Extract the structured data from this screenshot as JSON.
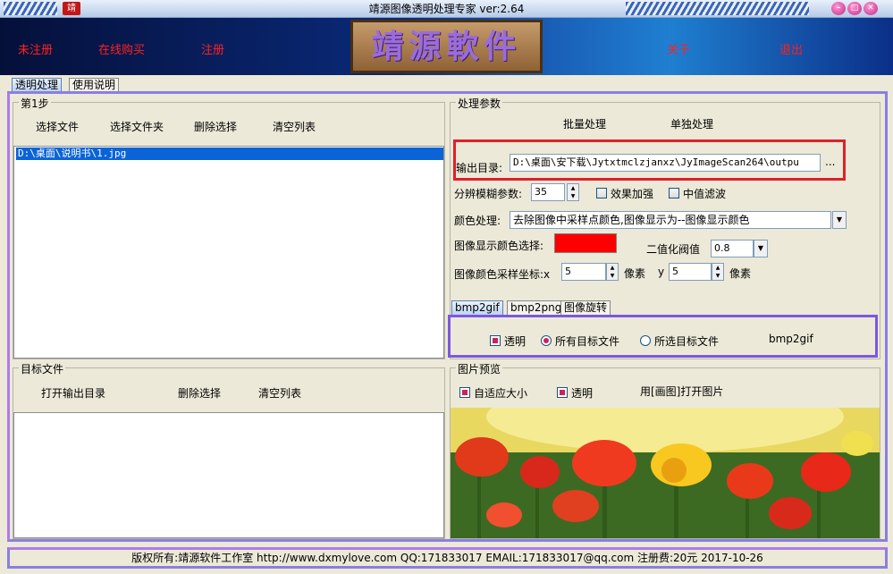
{
  "window": {
    "title": "靖源图像透明处理专家 ver:2.64",
    "btn_minimize": "–",
    "btn_maximize": "□",
    "btn_close": "✕",
    "app_icon": "靖"
  },
  "banner": {
    "links": [
      "未注册",
      "在线购买",
      "注册",
      "关于",
      "退出"
    ],
    "logo": "靖源軟件"
  },
  "tabs": [
    "透明处理",
    "使用说明"
  ],
  "step1": {
    "title": "第1步",
    "buttons": [
      "选择文件",
      "选择文件夹",
      "删除选择",
      "清空列表"
    ],
    "files": [
      "D:\\桌面\\说明书\\1.jpg"
    ]
  },
  "target": {
    "title": "目标文件",
    "buttons": [
      "打开输出目录",
      "删除选择",
      "清空列表"
    ]
  },
  "params": {
    "title": "处理参数",
    "buttons": [
      "批量处理",
      "单独处理"
    ],
    "output_label": "输出目录:",
    "output_value": "D:\\桌面\\安下载\\Jytxtmclzjanxz\\JyImageScan264\\outpu",
    "browse": "...",
    "blur_label": "分辨模糊参数:",
    "blur_value": "35",
    "enhance": "效果加强",
    "median": "中值滤波",
    "color_label": "颜色处理:",
    "color_value": "去除图像中采样点颜色,图像显示为--图像显示颜色",
    "display_color_label": "图像显示颜色选择:",
    "display_color": "#ff0000",
    "threshold_label": "二值化阀值",
    "threshold_value": "0.8",
    "sample_label": "图像颜色采样坐标:x",
    "x_value": "5",
    "px1": "像素",
    "y_label": "y",
    "y_value": "5",
    "px2": "像素"
  },
  "subtabs": [
    "bmp2gif",
    "bmp2png",
    "图像旋转"
  ],
  "bmp2gif": {
    "transparent": "透明",
    "all_files": "所有目标文件",
    "selected_files": "所选目标文件",
    "action": "bmp2gif"
  },
  "preview": {
    "title": "图片预览",
    "fit": "自适应大小",
    "transparent": "透明",
    "open_with_paint": "用[画图]打开图片"
  },
  "status": "版权所有:靖源软件工作室 http://www.dxmylove.com QQ:171833017 EMAIL:171833017@qq.com 注册费:20元 2017-10-26",
  "colors": {
    "accent_red": "#ff2020",
    "highlight_box": "#e0202a",
    "frame_purple": "#8a7fe0",
    "selection": "#0a64d8"
  }
}
